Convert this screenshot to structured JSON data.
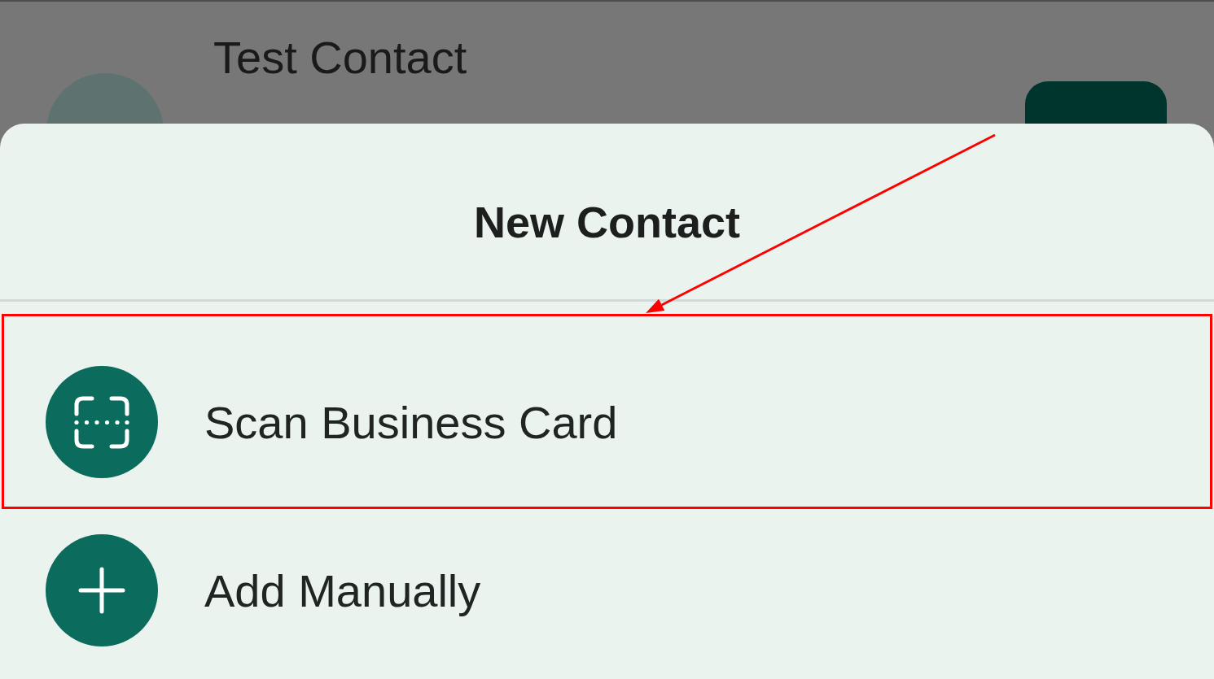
{
  "contact_list": {
    "rows": [
      {
        "name": "Test Contact"
      }
    ]
  },
  "sheet": {
    "title": "New Contact",
    "options": [
      {
        "kind": "scan",
        "label": "Scan Business Card",
        "highlighted": true
      },
      {
        "kind": "add",
        "label": "Add Manually",
        "highlighted": false
      }
    ]
  }
}
